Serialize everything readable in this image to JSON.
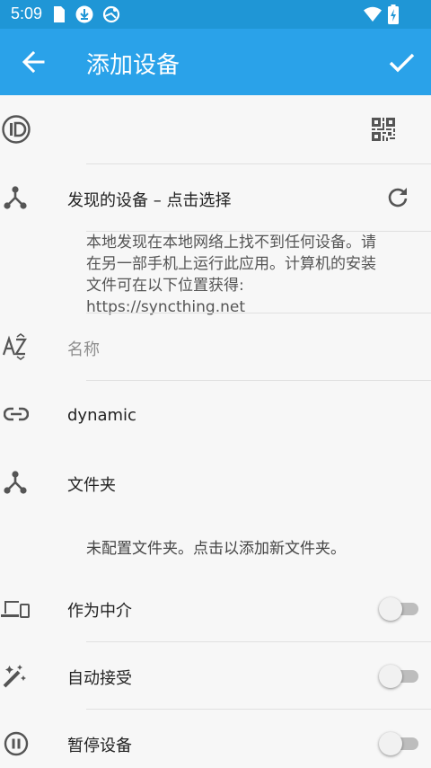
{
  "status_bar": {
    "time": "5:09"
  },
  "app_bar": {
    "title": "添加设备"
  },
  "device_id": {
    "value": ""
  },
  "discovered": {
    "label": "发现的设备 – 点击选择"
  },
  "discovery_message": "本地发现在本地网络上找不到任何设备。请在另一部手机上运行此应用。计算机的安装文件可在以下位置获得: https://syncthing.net",
  "name_field": {
    "placeholder": "名称"
  },
  "address": {
    "value": "dynamic"
  },
  "folders": {
    "label": "文件夹",
    "empty_message": "未配置文件夹。点击以添加新文件夹。"
  },
  "introducer": {
    "label": "作为中介",
    "on": false
  },
  "auto_accept": {
    "label": "自动接受",
    "on": false
  },
  "pause_device": {
    "label": "暂停设备",
    "on": false
  },
  "colors": {
    "status_bar": "#1f96d6",
    "app_bar": "#2aa2e9",
    "icon": "#555555"
  }
}
